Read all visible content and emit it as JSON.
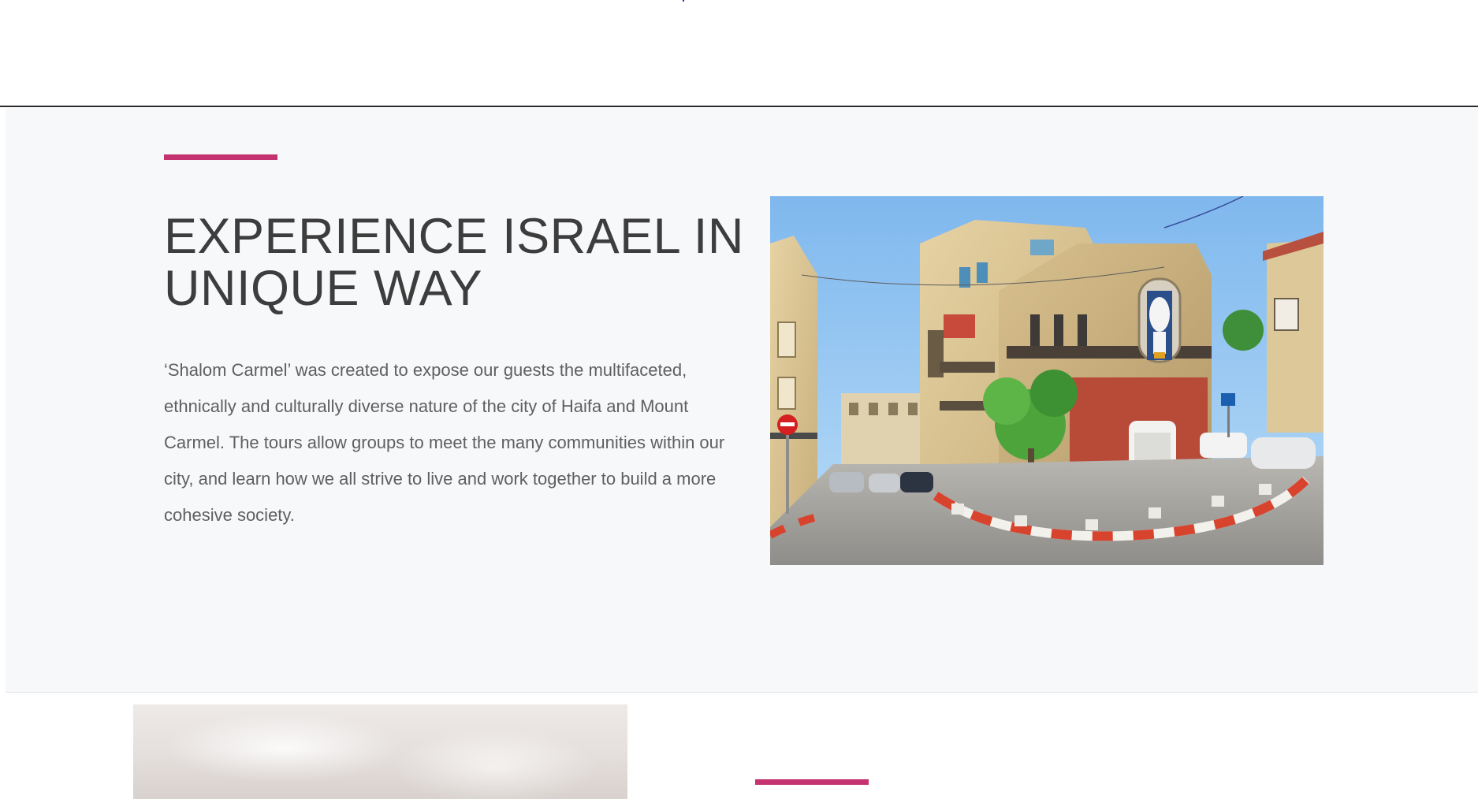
{
  "intro": {
    "heading": "EXPERIENCE ISRAEL IN UNIQUE WAY",
    "paragraph": "‘Shalom Carmel’ was created to expose our guests the multifaceted, ethnically and culturally diverse nature of the city of Haifa and Mount Carmel. The tours allow groups to meet the many communities within our city, and learn how we all strive to live and work together to build a more cohesive society."
  },
  "colors": {
    "accent": "#c4336f",
    "section_background": "#f7f8fa",
    "heading": "#3d3d3d",
    "body_text": "#5f5f5f"
  },
  "images": {
    "intro_photo": "haifa-street-photo",
    "lower_photo": "misty-photo"
  }
}
